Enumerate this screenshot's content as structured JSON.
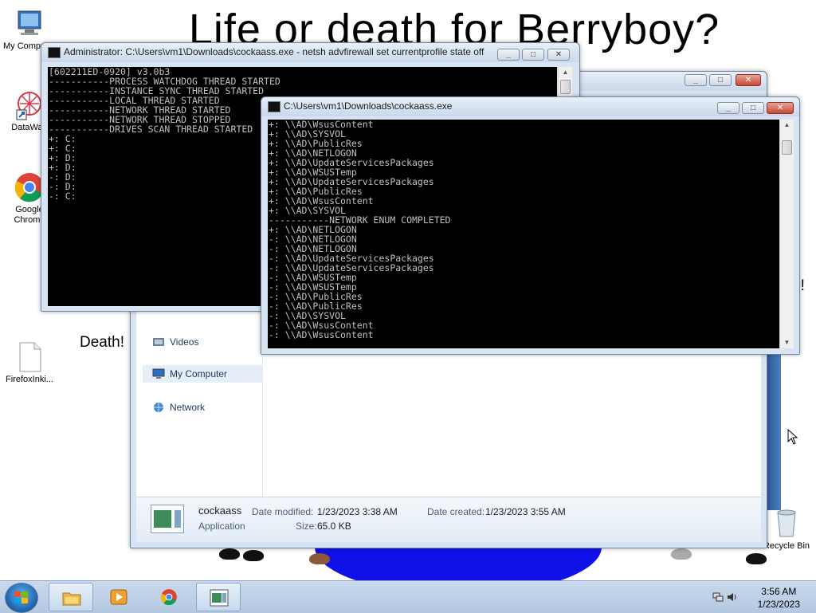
{
  "wallpaper": {
    "title": "Life or death for Berryboy?",
    "left_text": "Death!",
    "right_text_fragment": "n!"
  },
  "desktop_icons": [
    {
      "label": "My Computer",
      "icon": "computer-icon"
    },
    {
      "label": "DataWag",
      "icon": "datawag-icon"
    },
    {
      "label": "Google Chrome",
      "icon": "chrome-icon"
    },
    {
      "label": "FirefoxInki...",
      "icon": "file-icon"
    },
    {
      "label": "Recycle Bin",
      "icon": "recycle-bin-icon"
    }
  ],
  "console_admin": {
    "title": "Administrator: C:\\Users\\vm1\\Downloads\\cockaass.exe - netsh  advfirewall set currentprofile state off",
    "lines": [
      "[602211ED-0920] v3.0b3",
      "-----------PROCESS WATCHDOG THREAD STARTED",
      "-----------INSTANCE SYNC THREAD STARTED",
      "-----------LOCAL THREAD STARTED",
      "-----------NETWORK THREAD STARTED",
      "-----------NETWORK THREAD STOPPED",
      "-----------DRIVES SCAN THREAD STARTED",
      "+: C:",
      "+: C:",
      "+: D:",
      "+: D:",
      "-: D:",
      "-: D:",
      "-: C:"
    ]
  },
  "console_main": {
    "title": "C:\\Users\\vm1\\Downloads\\cockaass.exe",
    "lines": [
      "+: \\\\AD\\WsusContent",
      "+: \\\\AD\\SYSVOL",
      "+: \\\\AD\\PublicRes",
      "+: \\\\AD\\NETLOGON",
      "+: \\\\AD\\UpdateServicesPackages",
      "+: \\\\AD\\WSUSTemp",
      "+: \\\\AD\\UpdateServicesPackages",
      "+: \\\\AD\\PublicRes",
      "+: \\\\AD\\WsusContent",
      "+: \\\\AD\\SYSVOL",
      "-----------NETWORK ENUM COMPLETED",
      "+: \\\\AD\\NETLOGON",
      "-: \\\\AD\\NETLOGON",
      "-: \\\\AD\\NETLOGON",
      "-: \\\\AD\\UpdateServicesPackages",
      "-: \\\\AD\\UpdateServicesPackages",
      "-: \\\\AD\\WSUSTemp",
      "-: \\\\AD\\WSUSTemp",
      "-: \\\\AD\\PublicRes",
      "-: \\\\AD\\PublicRes",
      "-: \\\\AD\\SYSVOL",
      "-: \\\\AD\\WsusContent",
      "-: \\\\AD\\WsusContent"
    ]
  },
  "explorer": {
    "nav": {
      "videos": "Videos",
      "computer": "My Computer",
      "network": "Network"
    },
    "details": {
      "name": "cockaass",
      "type": "Application",
      "date_modified_label": "Date modified:",
      "date_modified": "1/23/2023 3:38 AM",
      "date_created_label": "Date created:",
      "date_created": "1/23/2023 3:55 AM",
      "size_label": "Size:",
      "size": "65.0 KB"
    }
  },
  "taskbar": {
    "items": [
      "explorer-icon",
      "media-player-icon",
      "chrome-icon",
      "console-app-icon"
    ],
    "clock_time": "3:56 AM",
    "clock_date": "1/23/2023"
  },
  "colors": {
    "console_bg": "#000000",
    "console_fg": "#c0c0c0",
    "wallpaper_blue": "#1010e8",
    "close_red": "#c74a36"
  }
}
